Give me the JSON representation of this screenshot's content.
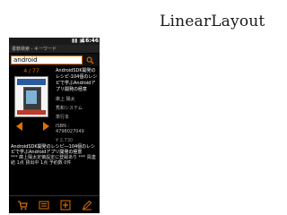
{
  "slide": {
    "title": "LinearLayout"
  },
  "status_bar": {
    "time": "16:46",
    "icons": "▮▮ ▣"
  },
  "title_bar": {
    "text": "書籍検索 - キーワード"
  },
  "search": {
    "value": "android"
  },
  "result": {
    "counter": "4 / 77",
    "title": "AndroidSDK開発のレシピ-104個のレシピで学ぶAndroidアプリ開発の極意",
    "author": "庫上 陽太",
    "publisher": "秀和システム",
    "date": "単行本",
    "isbn": "ISBN : 4798027049",
    "price": "¥ 2,730",
    "description_title": "AndroidSDK開発のレシピ―104個のレシピで学ぶAndroidアプリ開発の極意",
    "description_meta": "*** 庫上陽太定価設定に登録あり *** 買連結 1点 貸出中 1点 予約数 0件"
  },
  "toolbar": {
    "buttons": [
      "cart-icon",
      "list-icon",
      "add-icon",
      "edit-icon"
    ],
    "accent": "#e07000"
  },
  "colors": {
    "accent": "#e07000",
    "background": "#000000",
    "slide_bg": "#ffffff"
  }
}
